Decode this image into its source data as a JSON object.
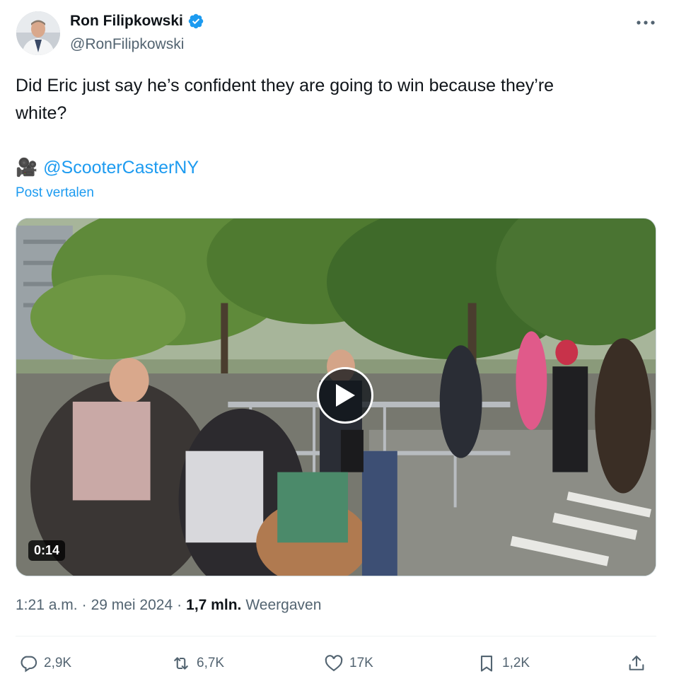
{
  "author": {
    "name": "Ron Filipkowski",
    "handle": "@RonFilipkowski",
    "verified": true,
    "avatar": "avatar"
  },
  "tweet": {
    "text_line1": "Did Eric just say he’s confident they are going to win because they’re",
    "text_line2": "white?",
    "credit_icon": "video-camera-icon",
    "credit_emoji": "🎥",
    "mention": "@ScooterCasterNY",
    "translate_label": "Post vertalen"
  },
  "media": {
    "type": "video",
    "duration": "0:14",
    "play_icon": "play-icon"
  },
  "meta": {
    "time": "1:21 a.m.",
    "sep1": "·",
    "date": "29 mei 2024",
    "sep2": "·",
    "views_count": "1,7 mln.",
    "views_label": "Weergaven"
  },
  "actions": {
    "replies": "2,9K",
    "reposts": "6,7K",
    "likes": "17K",
    "bookmarks": "1,2K"
  },
  "colors": {
    "accent": "#1d9bf0",
    "secondary_text": "#536471",
    "primary_text": "#0f1419"
  }
}
